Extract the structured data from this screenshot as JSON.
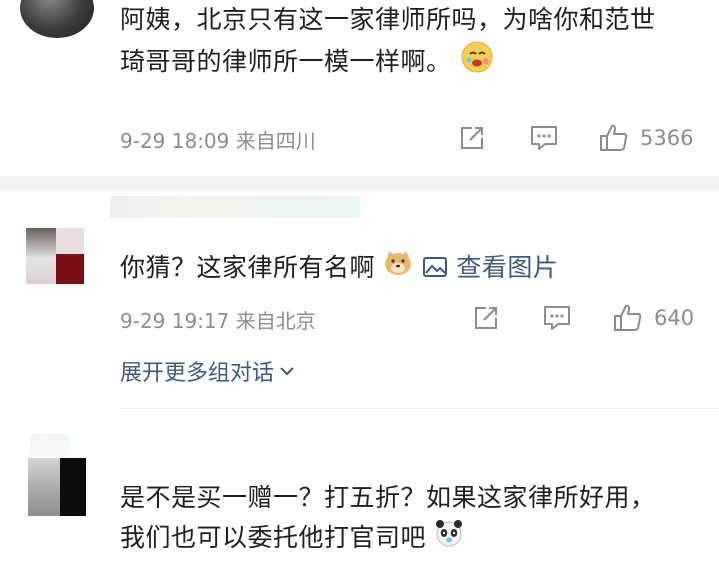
{
  "comments": [
    {
      "text_line1": "阿姨，北京只有这一家律师所吗，为啥你和范世",
      "text_line2": "琦哥哥的律师所一模一样啊。",
      "emoji": "laugh-cry-emoji",
      "time_location": "9-29 18:09 来自四川",
      "likes": "5366"
    },
    {
      "text": "你猜？这家律所有名啊",
      "emoji": "doge-emoji",
      "view_image_label": "查看图片",
      "time_location": "9-29 19:17 来自北京",
      "likes": "640",
      "more_label": "展开更多组对话"
    },
    {
      "text_line1": "是不是买一赠一？打五折？如果这家律所好用，",
      "text_line2": "我们也可以委托他打官司吧",
      "emoji": "panda-emoji"
    }
  ],
  "icons": [
    "share-icon",
    "comment-icon",
    "like-icon",
    "image-icon",
    "chevron-down-icon"
  ],
  "colors": {
    "link": "#3d5a80",
    "meta": "#8c8c8c",
    "divider": "#f2f2f2"
  }
}
